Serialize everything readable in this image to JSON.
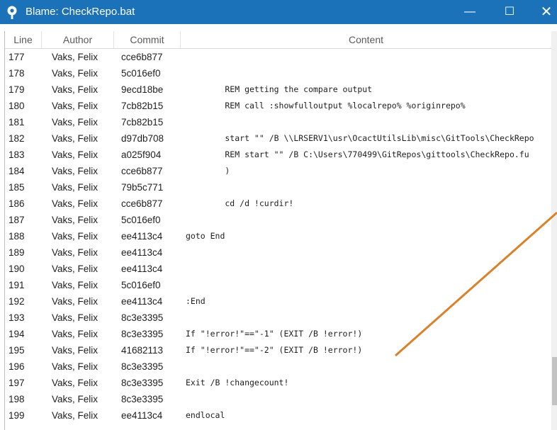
{
  "window": {
    "title": "Blame: CheckRepo.bat",
    "icons": {
      "app": "sourcetree-logo-icon",
      "minimize": "minimize-icon",
      "maximize": "maximize-icon",
      "close": "close-icon"
    },
    "minimize_glyph": "—",
    "maximize_glyph": "☐",
    "close_glyph": "✕"
  },
  "columns": {
    "line": "Line",
    "author": "Author",
    "commit": "Commit",
    "content": "Content"
  },
  "rows": [
    {
      "line": "177",
      "author": "Vaks, Felix",
      "commit": "cce6b877",
      "content": ""
    },
    {
      "line": "178",
      "author": "Vaks, Felix",
      "commit": "5c016ef0",
      "content": ""
    },
    {
      "line": "179",
      "author": "Vaks, Felix",
      "commit": "9ecd18be",
      "content": "        REM getting the compare output"
    },
    {
      "line": "180",
      "author": "Vaks, Felix",
      "commit": "7cb82b15",
      "content": "        REM call :showfulloutput %localrepo% %originrepo%"
    },
    {
      "line": "181",
      "author": "Vaks, Felix",
      "commit": "7cb82b15",
      "content": ""
    },
    {
      "line": "182",
      "author": "Vaks, Felix",
      "commit": "d97db708",
      "content": "        start \"\" /B \\\\LRSERV1\\usr\\OcactUtilsLib\\misc\\GitTools\\CheckRepo"
    },
    {
      "line": "183",
      "author": "Vaks, Felix",
      "commit": "a025f904",
      "content": "        REM start \"\" /B C:\\Users\\770499\\GitRepos\\gittools\\CheckRepo.fu"
    },
    {
      "line": "184",
      "author": "Vaks, Felix",
      "commit": "cce6b877",
      "content": "        )"
    },
    {
      "line": "185",
      "author": "Vaks, Felix",
      "commit": "79b5c771",
      "content": ""
    },
    {
      "line": "186",
      "author": "Vaks, Felix",
      "commit": "cce6b877",
      "content": "        cd /d !curdir!"
    },
    {
      "line": "187",
      "author": "Vaks, Felix",
      "commit": "5c016ef0",
      "content": ""
    },
    {
      "line": "188",
      "author": "Vaks, Felix",
      "commit": "ee4113c4",
      "content": "goto End"
    },
    {
      "line": "189",
      "author": "Vaks, Felix",
      "commit": "ee4113c4",
      "content": ""
    },
    {
      "line": "190",
      "author": "Vaks, Felix",
      "commit": "ee4113c4",
      "content": ""
    },
    {
      "line": "191",
      "author": "Vaks, Felix",
      "commit": "5c016ef0",
      "content": ""
    },
    {
      "line": "192",
      "author": "Vaks, Felix",
      "commit": "ee4113c4",
      "content": ":End"
    },
    {
      "line": "193",
      "author": "Vaks, Felix",
      "commit": "8c3e3395",
      "content": ""
    },
    {
      "line": "194",
      "author": "Vaks, Felix",
      "commit": "8c3e3395",
      "content": "If \"!error!\"==\"-1\" (EXIT /B !error!)"
    },
    {
      "line": "195",
      "author": "Vaks, Felix",
      "commit": "41682113",
      "content": "If \"!error!\"==\"-2\" (EXIT /B !error!)"
    },
    {
      "line": "196",
      "author": "Vaks, Felix",
      "commit": "8c3e3395",
      "content": ""
    },
    {
      "line": "197",
      "author": "Vaks, Felix",
      "commit": "8c3e3395",
      "content": "Exit /B !changecount!"
    },
    {
      "line": "198",
      "author": "Vaks, Felix",
      "commit": "8c3e3395",
      "content": ""
    },
    {
      "line": "199",
      "author": "Vaks, Felix",
      "commit": "ee4113c4",
      "content": "endlocal"
    }
  ],
  "scroll": {
    "position": 0.93,
    "visible_fraction": 0.12
  },
  "colors": {
    "titlebar": "#1b72b8",
    "annotation": "#d9822b"
  }
}
